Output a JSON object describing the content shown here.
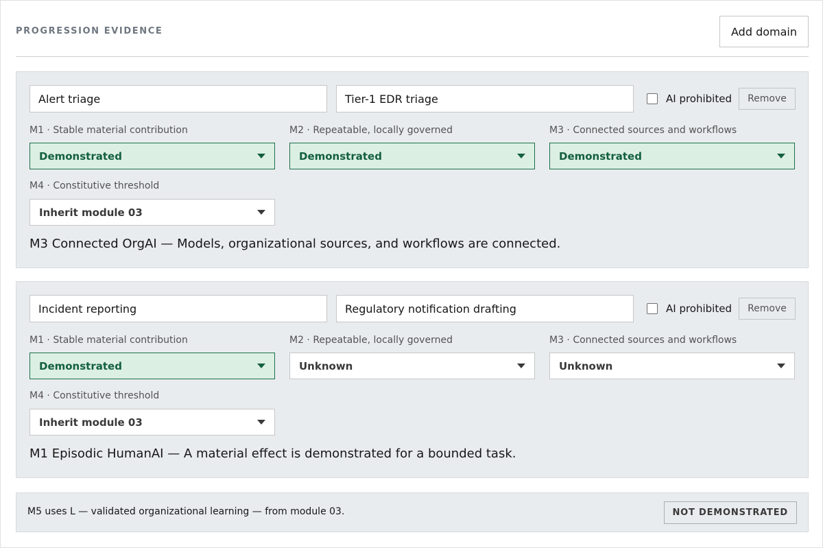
{
  "header": {
    "title": "PROGRESSION EVIDENCE",
    "add_domain_label": "Add domain"
  },
  "labels": {
    "m1": "M1 · Stable material contribution",
    "m2": "M2 · Repeatable, locally governed",
    "m3": "M3 · Connected sources and workflows",
    "m4": "M4 · Constitutive threshold",
    "ai_prohibited": "AI prohibited",
    "remove": "Remove"
  },
  "domains": [
    {
      "name": "Alert triage",
      "role": "Tier-1 EDR triage",
      "ai_prohibited": false,
      "m1": "Demonstrated",
      "m2": "Demonstrated",
      "m3": "Demonstrated",
      "m4": "Inherit module 03",
      "summary": "M3 Connected OrgAI — Models, organizational sources, and workflows are connected."
    },
    {
      "name": "Incident reporting",
      "role": "Regulatory notification drafting",
      "ai_prohibited": false,
      "m1": "Demonstrated",
      "m2": "Unknown",
      "m3": "Unknown",
      "m4": "Inherit module 03",
      "summary": "M1 Episodic HumanAI — A material effect is demonstrated for a bounded task."
    }
  ],
  "footer": {
    "text": "M5 uses L — validated organizational learning — from module 03.",
    "status": "NOT DEMONSTRATED"
  },
  "colors": {
    "demonstrated_bg": "#dcefe3",
    "demonstrated_border": "#1b6e4a",
    "demonstrated_text": "#13603f",
    "card_bg": "#e9ecef"
  }
}
